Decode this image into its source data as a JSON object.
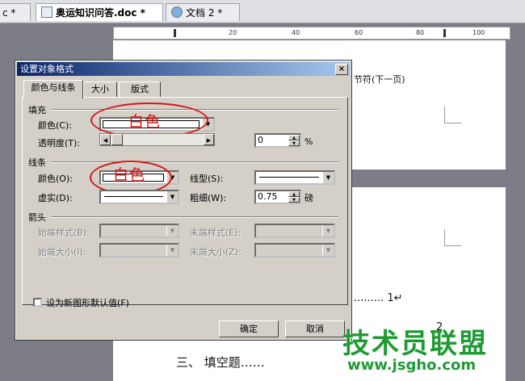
{
  "tabs": [
    {
      "label": "c *"
    },
    {
      "label": "奥运知识问答.doc *"
    },
    {
      "label": "文档 2 *"
    }
  ],
  "ruler": {
    "marks": [
      "20",
      "40",
      "60",
      "80",
      "100"
    ]
  },
  "document": {
    "section_break": "节符(下一页)",
    "toc_dots": "......... 1↵",
    "toc_num": "2",
    "fill_heading": "三、 填空题……"
  },
  "dialog": {
    "title": "设置对象格式",
    "close": "×",
    "tabs": [
      "颜色与线条",
      "大小",
      "版式"
    ],
    "fill": {
      "section": "填充",
      "color_label": "颜色(C):",
      "color_note": "白色",
      "transparency_label": "透明度(T):",
      "transparency_value": "0",
      "transparency_unit": "%"
    },
    "line": {
      "section": "线条",
      "color_label": "颜色(O):",
      "color_note": "白色",
      "type_label": "线型(S):",
      "dash_label": "虚实(D):",
      "weight_label": "粗细(W):",
      "weight_value": "0.75",
      "weight_unit": "磅"
    },
    "arrows": {
      "section": "箭头",
      "begin_style": "始端样式(B):",
      "end_style": "末端样式(E):",
      "begin_size": "始端大小(I):",
      "end_size": "末端大小(Z):"
    },
    "default_checkbox": "设为新图形默认值(F)",
    "ok": "确定",
    "cancel": "取消"
  },
  "watermark": {
    "text": "技术员联盟",
    "url": "www.jsgho.com"
  }
}
